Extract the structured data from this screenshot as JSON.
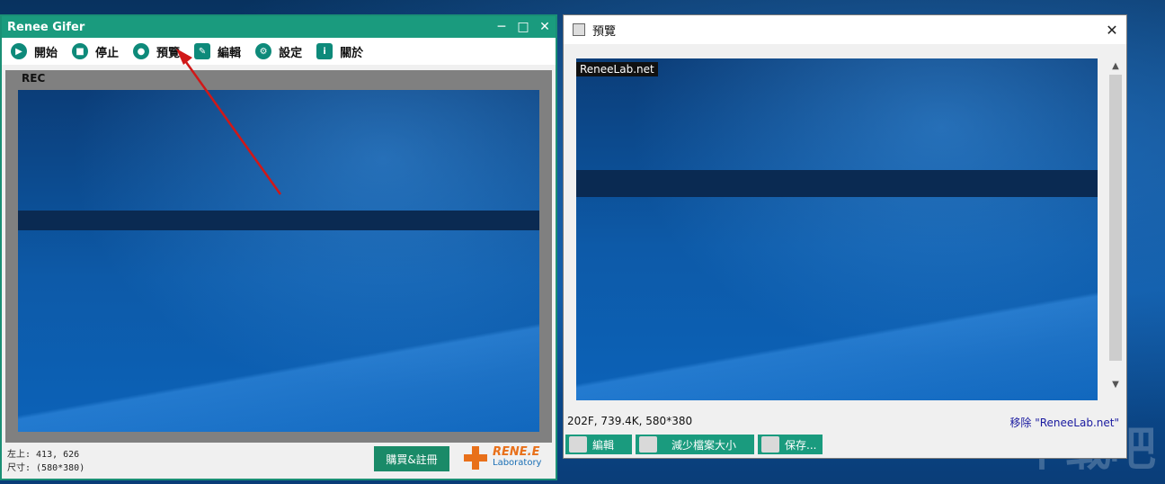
{
  "gifer": {
    "title": "Renee Gifer",
    "controls": {
      "minimize": "─",
      "maximize": "□",
      "close": "✕"
    },
    "toolbar": [
      {
        "label": "開始",
        "icon": "play-icon"
      },
      {
        "label": "停止",
        "icon": "stop-icon"
      },
      {
        "label": "預覽",
        "icon": "preview-icon"
      },
      {
        "label": "編輯",
        "icon": "edit-icon"
      },
      {
        "label": "設定",
        "icon": "gear-icon"
      },
      {
        "label": "關於",
        "icon": "info-icon"
      }
    ],
    "rec_label": "REC",
    "status": {
      "pos": "左上: 413, 626",
      "size": "尺寸: (580*380)"
    },
    "buy_button": "購買&註冊",
    "logo": {
      "line1": "RENE.E",
      "line2": "Laboratory"
    }
  },
  "preview": {
    "title": "預覽",
    "close": "✕",
    "watermark_label": "ReneeLab.net",
    "info": "202F, 739.4K, 580*380",
    "remove_label": "移除",
    "remove_target": "\"ReneeLab.net\"",
    "buttons": [
      {
        "label": "編輯",
        "icon": "edit-icon"
      },
      {
        "label": "減少檔案大小",
        "icon": "gif-icon"
      },
      {
        "label": "保存...",
        "icon": "save-folder-icon"
      }
    ]
  },
  "desktop": {
    "watermark": "下载吧"
  },
  "colors": {
    "accent": "#1a9b7e",
    "logo_orange": "#e8701a"
  }
}
